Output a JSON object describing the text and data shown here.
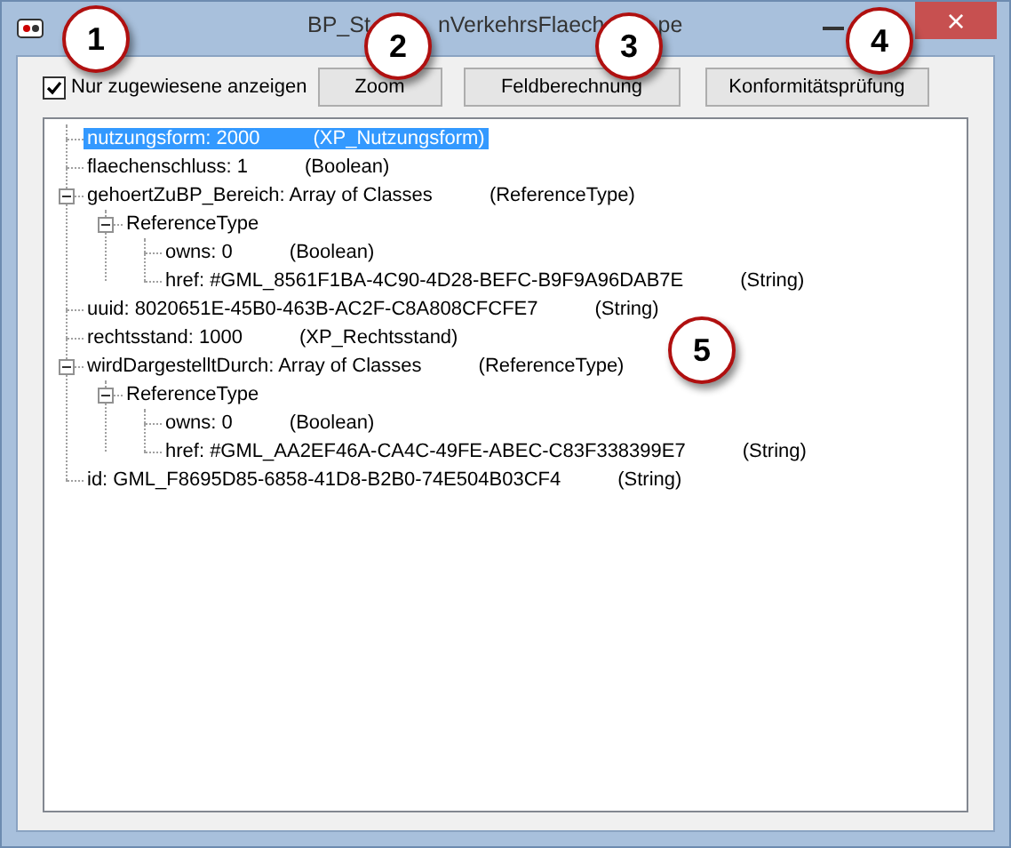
{
  "window": {
    "title_parts": [
      "BP_St",
      "nVerkehrsFlaech",
      "pe"
    ],
    "close": "×"
  },
  "toolbar": {
    "checkbox": {
      "label": "Nur zugewiesene anzeigen",
      "checked": true
    },
    "buttons": [
      "Zoom",
      "Feldberechnung",
      "Konformitätsprüfung"
    ]
  },
  "tree": [
    {
      "text": "nutzungsform: 2000",
      "type": "(XP_Nutzungsform)",
      "selected": true
    },
    {
      "text": "flaechenschluss: 1",
      "type": "(Boolean)",
      "selected": false
    },
    {
      "text": "gehoertZuBP_Bereich: Array of Classes",
      "type": "(ReferenceType)",
      "selected": false,
      "expanded": true,
      "children": [
        {
          "text": "ReferenceType",
          "selected": false,
          "expanded": true,
          "children": [
            {
              "text": "owns: 0",
              "type": "(Boolean)",
              "selected": false
            },
            {
              "text": "href: #GML_8561F1BA-4C90-4D28-BEFC-B9F9A96DAB7E",
              "type": "(String)",
              "selected": false
            }
          ]
        }
      ]
    },
    {
      "text": "uuid: 8020651E-45B0-463B-AC2F-C8A808CFCFE7",
      "type": "(String)",
      "selected": false
    },
    {
      "text": "rechtsstand: 1000",
      "type": "(XP_Rechtsstand)",
      "selected": false
    },
    {
      "text": "wirdDargestelltDurch: Array of Classes",
      "type": "(ReferenceType)",
      "selected": false,
      "expanded": true,
      "children": [
        {
          "text": "ReferenceType",
          "selected": false,
          "expanded": true,
          "children": [
            {
              "text": "owns: 0",
              "type": "(Boolean)",
              "selected": false
            },
            {
              "text": "href: #GML_AA2EF46A-CA4C-49FE-ABEC-C83F338399E7",
              "type": "(String)",
              "selected": false
            }
          ]
        }
      ]
    },
    {
      "text": "id: GML_F8695D85-6858-41D8-B2B0-74E504B03CF4",
      "type": "(String)",
      "selected": false
    }
  ],
  "callouts": [
    "1",
    "2",
    "3",
    "4",
    "5"
  ]
}
